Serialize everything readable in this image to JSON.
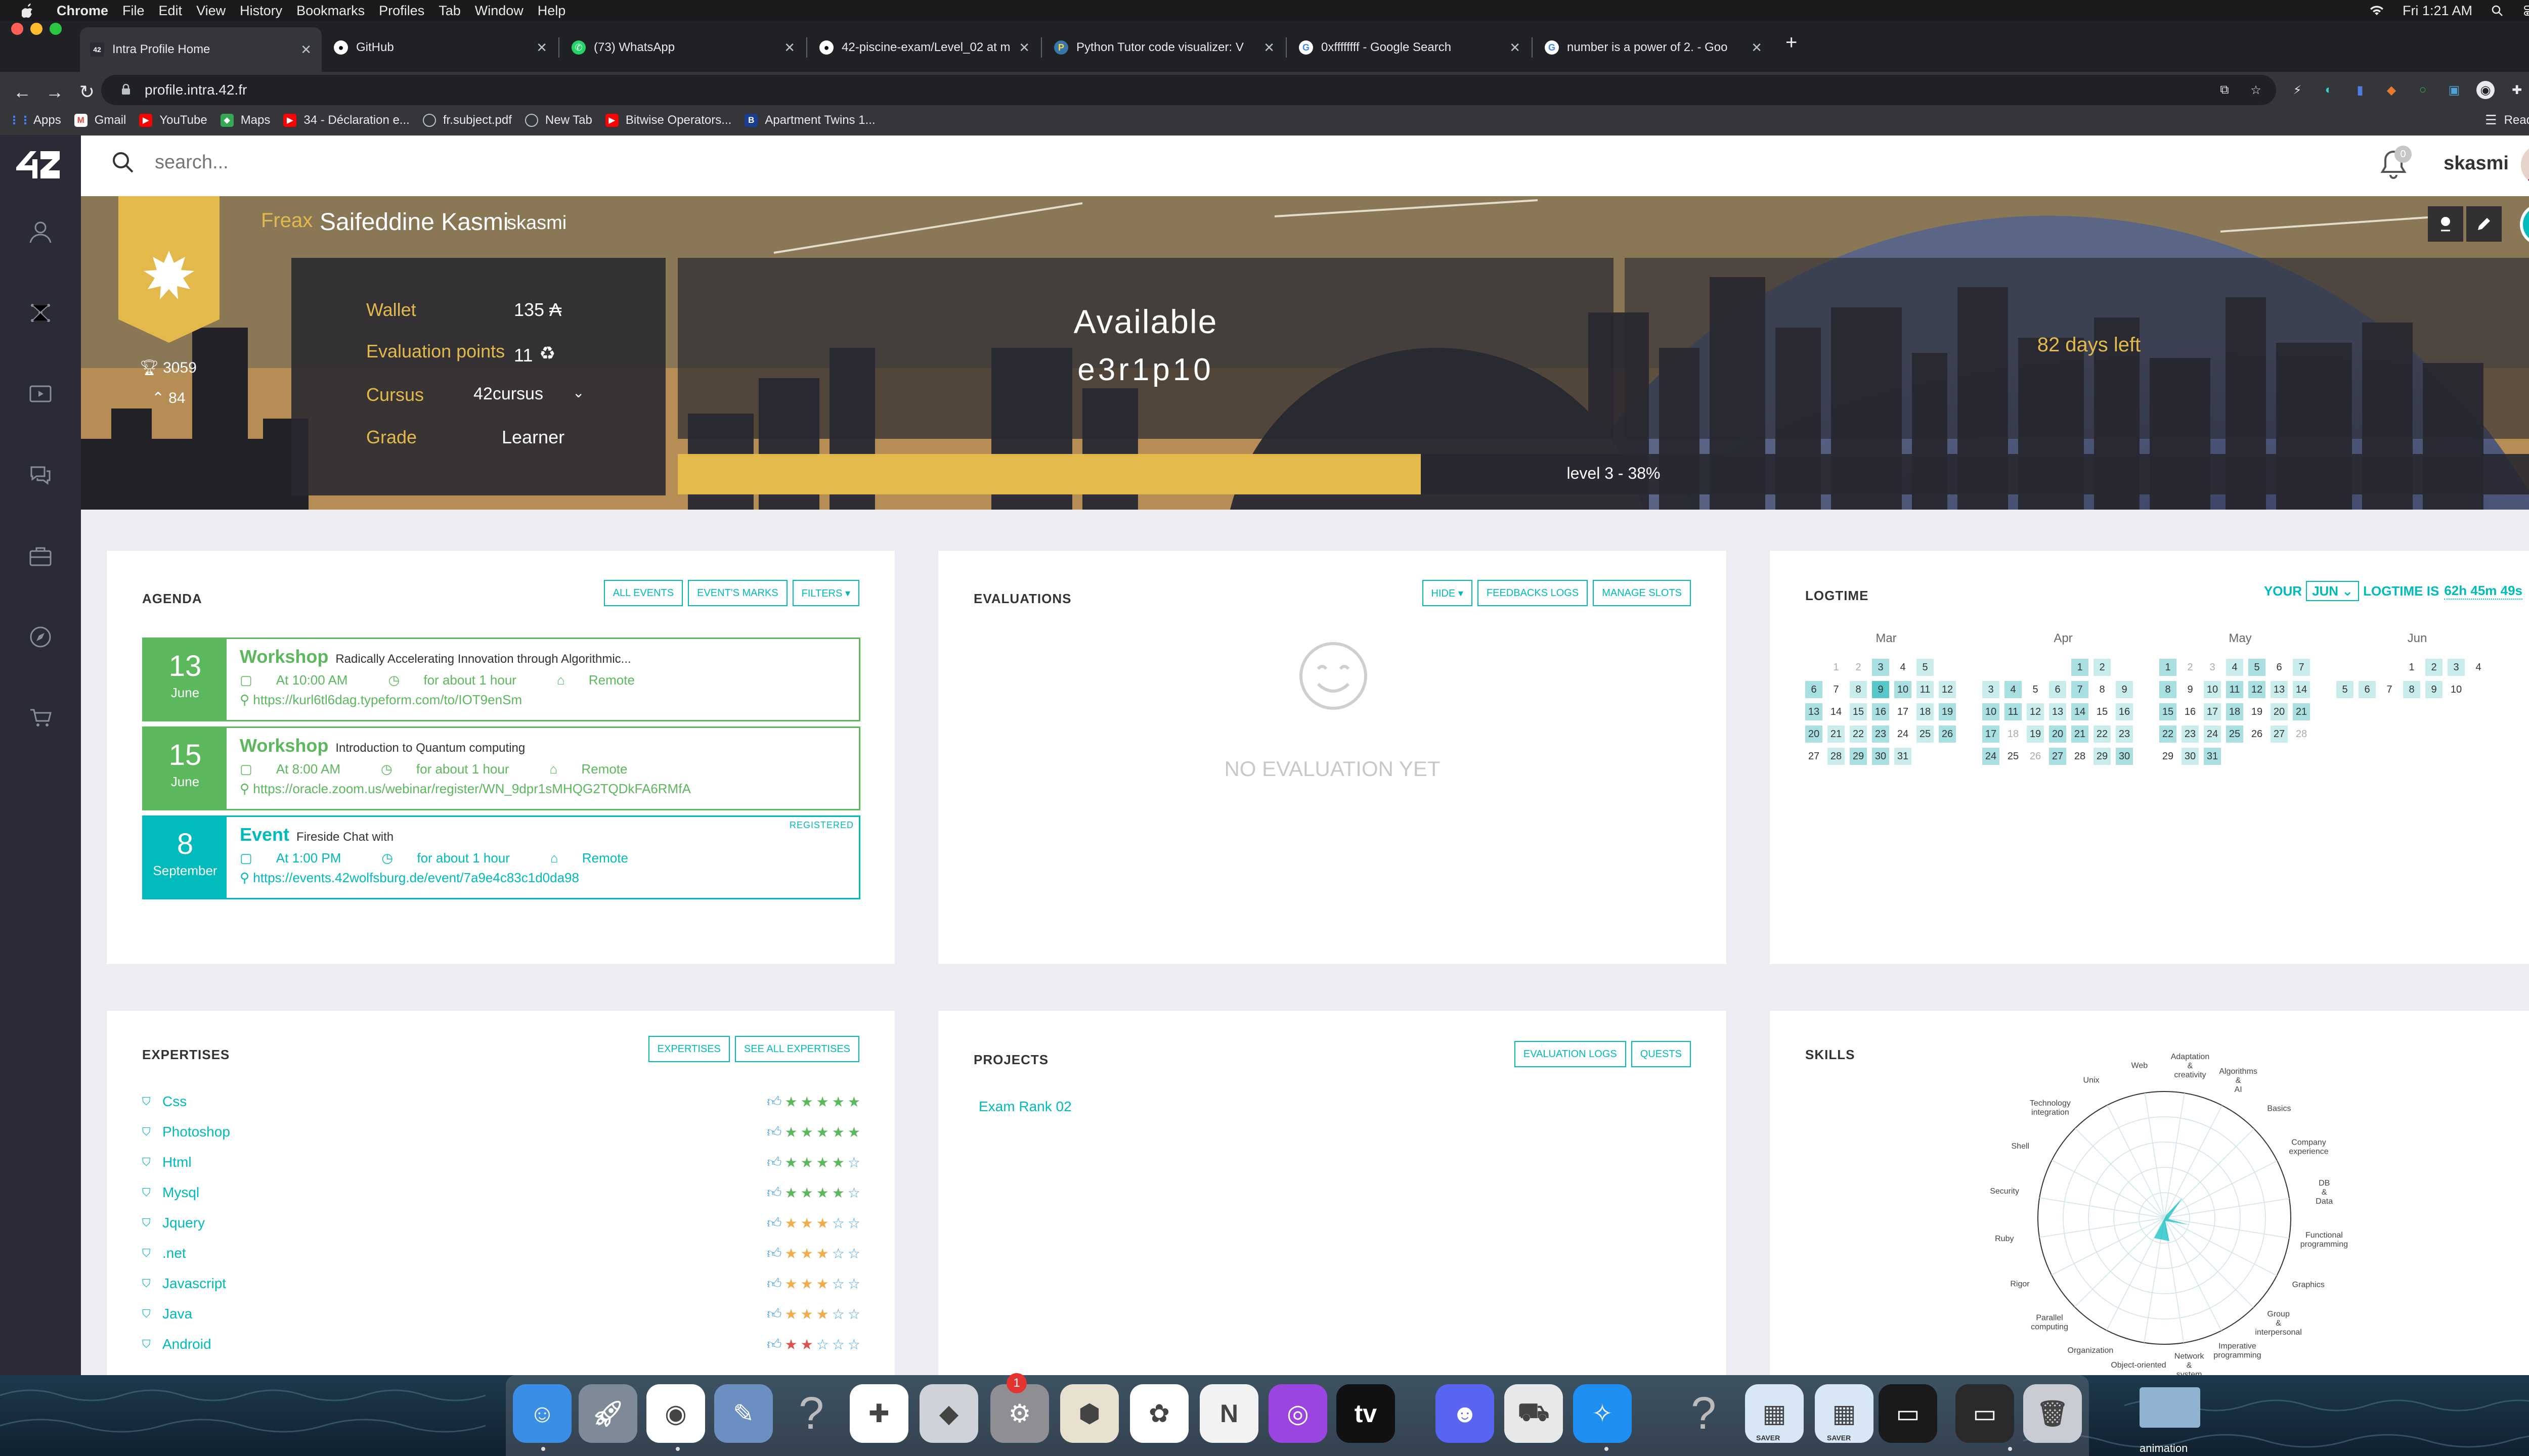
{
  "mac_menu": {
    "app": "Chrome",
    "items": [
      "File",
      "Edit",
      "View",
      "History",
      "Bookmarks",
      "Profiles",
      "Tab",
      "Window",
      "Help"
    ],
    "clock": "Fri 1:21 AM"
  },
  "tabs": [
    {
      "title": "Intra Profile Home",
      "icon": "42-icon",
      "color": "#2a2b36"
    },
    {
      "title": "GitHub",
      "icon": "github-icon",
      "color": "#fff"
    },
    {
      "title": "(73) WhatsApp",
      "icon": "whatsapp-icon",
      "color": "#25d366"
    },
    {
      "title": "42-piscine-exam/Level_02 at m",
      "icon": "github-icon",
      "color": "#fff"
    },
    {
      "title": "Python Tutor code visualizer: V",
      "icon": "python-icon",
      "color": "#3776ab"
    },
    {
      "title": "0xffffffff - Google Search",
      "icon": "google-icon",
      "color": "#fff"
    },
    {
      "title": "number is a power of 2. - Goo",
      "icon": "google-icon",
      "color": "#fff"
    }
  ],
  "address": {
    "url": "profile.intra.42.fr"
  },
  "bookmarks": [
    {
      "label": "Apps",
      "icon": "apps-grid-icon",
      "color": "#4285f4"
    },
    {
      "label": "Gmail",
      "icon": "gmail-icon",
      "color": "#ea4335"
    },
    {
      "label": "YouTube",
      "icon": "youtube-icon",
      "color": "#ff0000"
    },
    {
      "label": "Maps",
      "icon": "maps-icon",
      "color": "#34a853"
    },
    {
      "label": "34 - Déclaration e...",
      "icon": "youtube-icon",
      "color": "#ff0000"
    },
    {
      "label": "fr.subject.pdf",
      "icon": "globe-icon",
      "color": "#9aa0a6"
    },
    {
      "label": "New Tab",
      "icon": "globe-icon",
      "color": "#9aa0a6"
    },
    {
      "label": "Bitwise Operators...",
      "icon": "youtube-icon",
      "color": "#ff0000"
    },
    {
      "label": "Apartment Twins 1...",
      "icon": "b-icon",
      "color": "#1a3e8f"
    }
  ],
  "reading_list": "Reading List",
  "topbar": {
    "search_placeholder": "search...",
    "notif_count": "0",
    "username": "skasmi"
  },
  "profile": {
    "coalition": "Freax",
    "full_name": "Saifeddine Kasmi",
    "login": "skasmi",
    "coalition_score": "3059",
    "coalition_rank": "84",
    "wallet_label": "Wallet",
    "wallet_value": "135 ₳",
    "eval_label": "Evaluation points",
    "eval_value": "11",
    "cursus_label": "Cursus",
    "cursus_value": "42cursus",
    "grade_label": "Grade",
    "grade_value": "Learner",
    "availability": "Available",
    "host": "e3r1p10",
    "days_left": "82 days left",
    "level_text": "level 3 - 38%",
    "level_progress": 0.38
  },
  "agenda": {
    "title": "AGENDA",
    "buttons": [
      "ALL EVENTS",
      "EVENT'S MARKS",
      "FILTERS ▾"
    ],
    "events": [
      {
        "day": "13",
        "month": "June",
        "kind": "Workshop",
        "desc": "Radically Accelerating Innovation through Algorithmic...",
        "time": "At 10:00 AM",
        "duration": "for about 1 hour",
        "location": "Remote",
        "url": "https://kurl6tl6dag.typeform.com/to/IOT9enSm",
        "registered": "",
        "style": "green"
      },
      {
        "day": "15",
        "month": "June",
        "kind": "Workshop",
        "desc": "Introduction to Quantum computing",
        "time": "At 8:00 AM",
        "duration": "for about 1 hour",
        "location": "Remote",
        "url": "https://oracle.zoom.us/webinar/register/WN_9dpr1sMHQG2TQDkFA6RMfA",
        "registered": "",
        "style": "green"
      },
      {
        "day": "8",
        "month": "September",
        "kind": "Event",
        "desc": "Fireside Chat with",
        "time": "At 1:00 PM",
        "duration": "for about 1 hour",
        "location": "Remote",
        "url": "https://events.42wolfsburg.de/event/7a9e4c83c1d0da98",
        "registered": "REGISTERED",
        "style": "blue"
      }
    ]
  },
  "evaluations": {
    "title": "EVALUATIONS",
    "buttons": [
      "HIDE ▾",
      "FEEDBACKS LOGS",
      "MANAGE SLOTS"
    ],
    "empty": "NO EVALUATION YET"
  },
  "logtime": {
    "title": "LOGTIME",
    "prefix": "YOUR",
    "month_select": "JUN",
    "suffix": "LOGTIME IS",
    "total": "62h 45m 49s",
    "months": [
      {
        "name": "Mar",
        "weeks": [
          [
            "",
            "1",
            "2",
            "3",
            "4",
            "5"
          ],
          [
            "6",
            "7",
            "8",
            "9",
            "10",
            "11",
            "12"
          ],
          [
            "13",
            "14",
            "15",
            "16",
            "17",
            "18",
            "19"
          ],
          [
            "20",
            "21",
            "22",
            "23",
            "24",
            "25",
            "26"
          ],
          [
            "27",
            "28",
            "29",
            "30",
            "31"
          ]
        ],
        "lead": 1
      },
      {
        "name": "Apr",
        "weeks": [
          [
            "",
            "",
            "",
            "",
            "1",
            "2"
          ],
          [
            "3",
            "4",
            "5",
            "6",
            "7",
            "8",
            "9"
          ],
          [
            "10",
            "11",
            "12",
            "13",
            "14",
            "15",
            "16"
          ],
          [
            "17",
            "18",
            "19",
            "20",
            "21",
            "22",
            "23"
          ],
          [
            "24",
            "25",
            "26",
            "27",
            "28",
            "29",
            "30"
          ]
        ],
        "lead": 4
      },
      {
        "name": "May",
        "weeks": [
          [
            "1",
            "2",
            "3",
            "4",
            "5",
            "6",
            "7"
          ],
          [
            "8",
            "9",
            "10",
            "11",
            "12",
            "13",
            "14"
          ],
          [
            "15",
            "16",
            "17",
            "18",
            "19",
            "20",
            "21"
          ],
          [
            "22",
            "23",
            "24",
            "25",
            "26",
            "27",
            "28"
          ],
          [
            "29",
            "30",
            "31"
          ]
        ],
        "lead": 0
      },
      {
        "name": "Jun",
        "weeks": [
          [
            "",
            "",
            "",
            "1",
            "2",
            "3",
            "4"
          ],
          [
            "5",
            "6",
            "7",
            "8",
            "9",
            "10"
          ]
        ],
        "lead": 3
      }
    ]
  },
  "expertises": {
    "title": "EXPERTISES",
    "buttons": [
      "EXPERTISES",
      "SEE ALL EXPERTISES"
    ],
    "items": [
      {
        "name": "Css",
        "rating": 5
      },
      {
        "name": "Photoshop",
        "rating": 5
      },
      {
        "name": "Html",
        "rating": 4
      },
      {
        "name": "Mysql",
        "rating": 4
      },
      {
        "name": "Jquery",
        "rating": 3
      },
      {
        "name": ".net",
        "rating": 3
      },
      {
        "name": "Javascript",
        "rating": 3
      },
      {
        "name": "Java",
        "rating": 3
      },
      {
        "name": "Android",
        "rating": 2
      }
    ]
  },
  "projects": {
    "title": "PROJECTS",
    "buttons": [
      "EVALUATION LOGS",
      "QUESTS"
    ],
    "items": [
      "Exam Rank 02"
    ]
  },
  "skills": {
    "title": "SKILLS",
    "labels": [
      "Adaptation & creativity",
      "Algorithms & AI",
      "Basics",
      "Company experience",
      "DB & Data",
      "Functional programming",
      "Graphics",
      "Group & interpersonal",
      "Imperative programming",
      "Network & system",
      "Object-oriented",
      "Organization",
      "Parallel computing",
      "Rigor",
      "Ruby",
      "Security",
      "Shell",
      "Technology integration",
      "Unix",
      "Web"
    ]
  },
  "dock": [
    {
      "name": "finder-icon",
      "color": "#3a8ee6"
    },
    {
      "name": "launchpad-icon",
      "color": "#7f8a99"
    },
    {
      "name": "chrome-icon",
      "color": "#ffffff"
    },
    {
      "name": "preview-icon",
      "color": "#6a8fc0"
    },
    {
      "name": "question-icon",
      "color": "transparent"
    },
    {
      "name": "slack-icon",
      "color": "#ffffff"
    },
    {
      "name": "boot-camp-icon",
      "color": "#cfd3d9"
    },
    {
      "name": "system-preferences-icon",
      "color": "#8e8e93"
    },
    {
      "name": "maps-icon",
      "color": "#e8e1cf"
    },
    {
      "name": "photos-icon",
      "color": "#ffffff"
    },
    {
      "name": "news-icon",
      "color": "#f2f2f2"
    },
    {
      "name": "podcasts-icon",
      "color": "#9b45e0"
    },
    {
      "name": "apple-tv-icon",
      "color": "#111111"
    },
    {
      "name": "discord-icon",
      "color": "#5865f2"
    },
    {
      "name": "asphalt-icon",
      "color": "#e8e8e8"
    },
    {
      "name": "safari-icon",
      "color": "#1f8ef1"
    },
    {
      "name": "question-icon",
      "color": "transparent"
    },
    {
      "name": "screensaver-icon",
      "color": "#d8e7f5"
    },
    {
      "name": "screensaver-icon",
      "color": "#d8e7f5"
    },
    {
      "name": "window-thumb-icon",
      "color": "#1a1a1a"
    },
    {
      "name": "window-thumb-icon",
      "color": "#2a2a2a"
    },
    {
      "name": "trash-icon",
      "color": "#c8ccd2"
    }
  ],
  "dock_badge": "1",
  "dock_labels": {
    "saver1": "SAVER",
    "saver2": "SAVER",
    "folder": "animation"
  },
  "colors": {
    "accent": "#00babc",
    "gold": "#e4b94b",
    "green": "#5cb85c"
  }
}
